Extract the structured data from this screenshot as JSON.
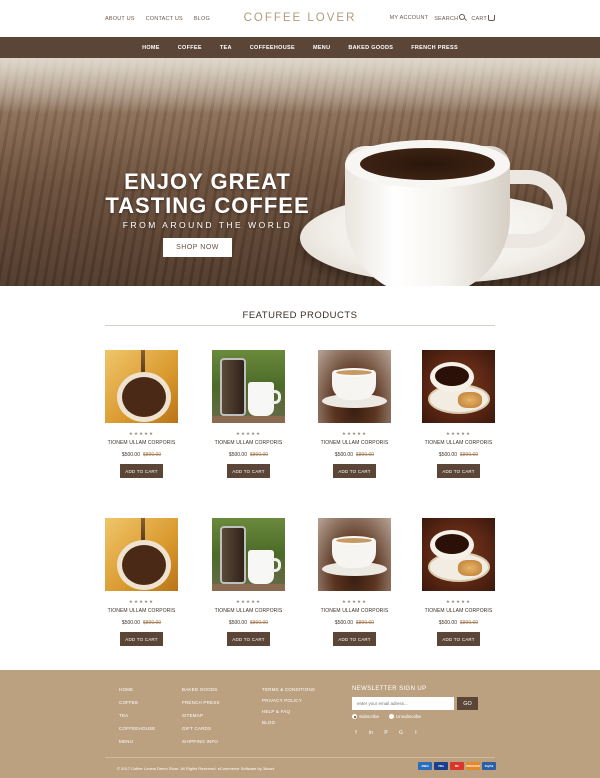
{
  "header": {
    "links": [
      "ABOUT US",
      "CONTACT US",
      "BLOG"
    ],
    "logo": "COFFEE LOVER",
    "account": "MY ACCOUNT",
    "search": "SEARCH",
    "cart": "CART"
  },
  "nav": [
    "HOME",
    "COFFEE",
    "TEA",
    "COFFEEHOUSE",
    "MENU",
    "BAKED GOODS",
    "FRENCH PRESS"
  ],
  "hero": {
    "line1": "ENJOY GREAT",
    "line2": "TASTING COFFEE",
    "line3": "FROM AROUND THE WORLD",
    "cta": "SHOP NOW"
  },
  "featured": {
    "title": "FEATURED PRODUCTS",
    "stars": "★★★★★",
    "add_to_cart": "ADD TO CART",
    "products": [
      {
        "name": "TIONEM ULLAM CORPORIS",
        "price": "$500.00",
        "old_price": "$890.00",
        "image": "coffee-pour-cup"
      },
      {
        "name": "TIONEM ULLAM CORPORIS",
        "price": "$500.00",
        "old_price": "$890.00",
        "image": "french-press-and-cup"
      },
      {
        "name": "TIONEM ULLAM CORPORIS",
        "price": "$500.00",
        "old_price": "$890.00",
        "image": "cup-on-beans"
      },
      {
        "name": "TIONEM ULLAM CORPORIS",
        "price": "$500.00",
        "old_price": "$890.00",
        "image": "cup-with-pastry"
      },
      {
        "name": "TIONEM ULLAM CORPORIS",
        "price": "$500.00",
        "old_price": "$890.00",
        "image": "coffee-pour-cup"
      },
      {
        "name": "TIONEM ULLAM CORPORIS",
        "price": "$500.00",
        "old_price": "$890.00",
        "image": "french-press-and-cup"
      },
      {
        "name": "TIONEM ULLAM CORPORIS",
        "price": "$500.00",
        "old_price": "$890.00",
        "image": "cup-on-beans"
      },
      {
        "name": "TIONEM ULLAM CORPORIS",
        "price": "$500.00",
        "old_price": "$890.00",
        "image": "cup-with-pastry"
      }
    ]
  },
  "footer": {
    "col1": [
      "HOME",
      "COFFEE",
      "TEA",
      "COFFEEHOUSE",
      "MENU"
    ],
    "col2": [
      "BAKED GOODS",
      "FRENCH PRESS",
      "SITEMAP",
      "GIFT CARDS",
      "SHIPPING INFO"
    ],
    "col3": [
      "TERMS & CONDITIONS",
      "PRIVACY POLICY",
      "HELP & FAQ",
      "BLOG"
    ],
    "newsletter_title": "NEWSLETTER SIGN UP",
    "email_placeholder": "enter your email adress...",
    "go_label": "GO",
    "subscribe": "Subscribe",
    "unsubscribe": "Unsubscribe",
    "socials": [
      "f",
      "in",
      "P",
      "G",
      "t"
    ],
    "copyright": "© 2017 Coffee Lovers Demo Store. All Rights Reserved. eCommerce Software by 3dcart.",
    "payments": [
      {
        "label": "AMEX",
        "color": "#2a6ebb"
      },
      {
        "label": "VISA",
        "color": "#1a3f8f"
      },
      {
        "label": "MC",
        "color": "#d9372a"
      },
      {
        "label": "DISCOVER",
        "color": "#e58a2a"
      },
      {
        "label": "PayPal",
        "color": "#2b5fa6"
      }
    ]
  },
  "colors": {
    "brown": "#5a4537",
    "footer": "#bba17f",
    "logo": "#b39a7c"
  }
}
